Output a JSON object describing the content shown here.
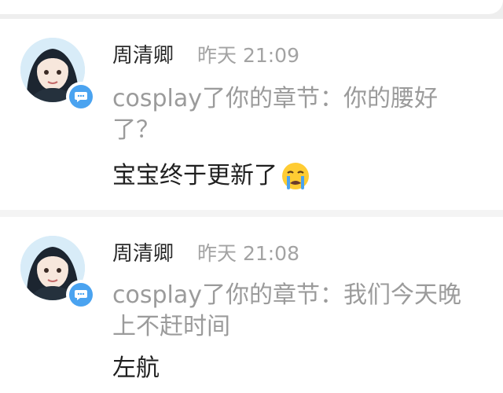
{
  "messages": [
    {
      "user": "周清卿",
      "time": "昨天 21:09",
      "quote": "cosplay了你的章节：你的腰好了？",
      "reply": "宝宝终于更新了",
      "reply_emoji": "loudly-crying-face-icon"
    },
    {
      "user": "周清卿",
      "time": "昨天 21:08",
      "quote": "cosplay了你的章节：我们今天晚上不赶时间",
      "reply": "左航"
    }
  ],
  "colors": {
    "badge": "#4aa3f0",
    "name": "#2a2a2a",
    "time": "#a3a3a3",
    "quote": "#9b9b9b",
    "reply": "#1f1f1f"
  }
}
